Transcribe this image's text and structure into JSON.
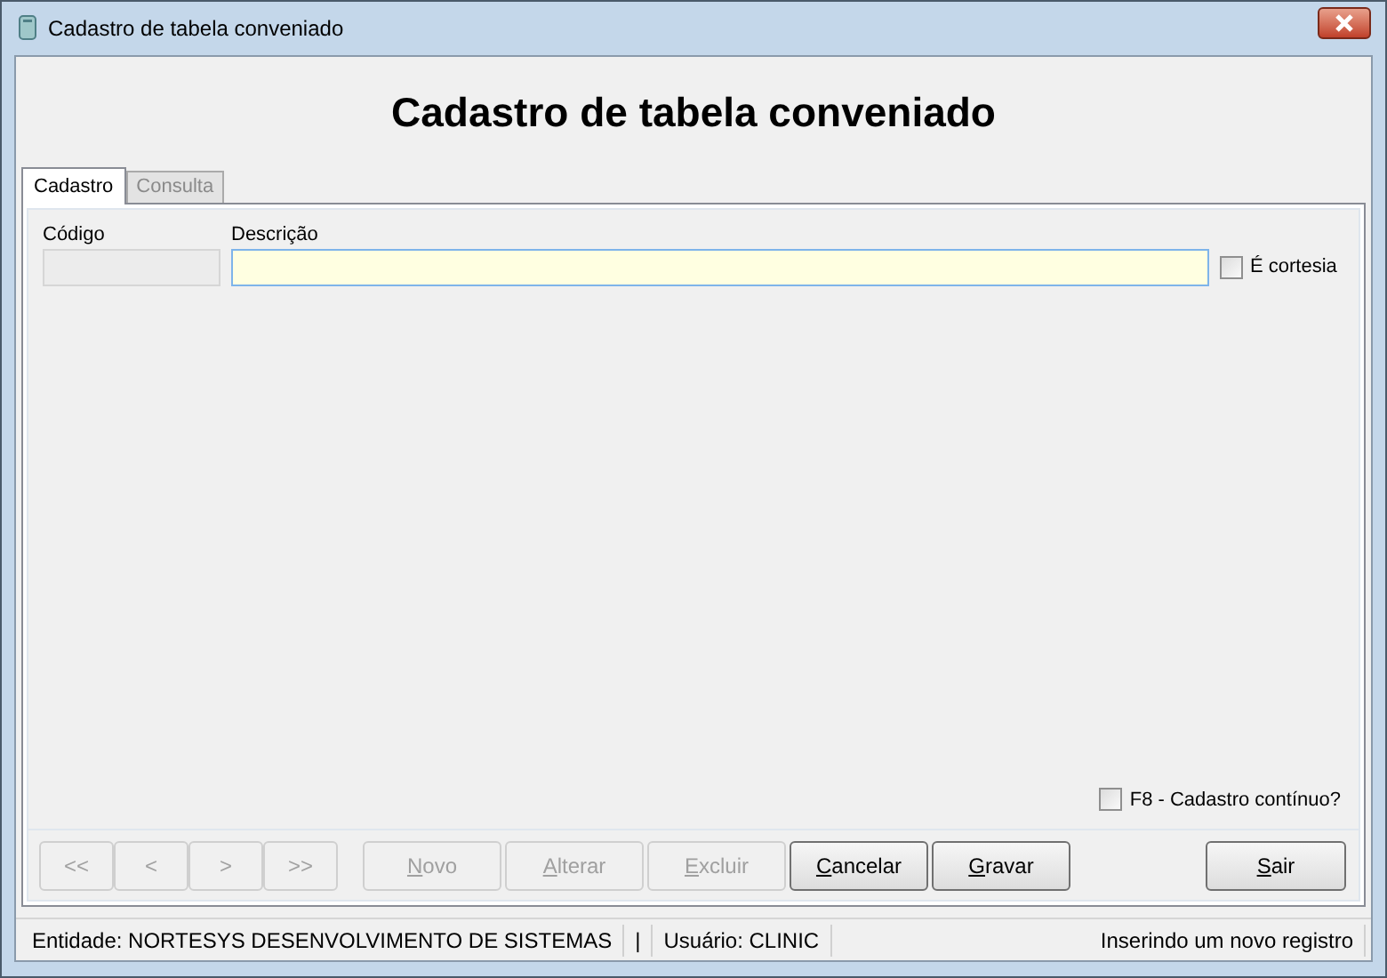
{
  "window": {
    "title": "Cadastro de tabela conveniado"
  },
  "heading": "Cadastro de tabela conveniado",
  "tabs": [
    {
      "label": "Cadastro",
      "selected": true
    },
    {
      "label": "Consulta",
      "selected": false
    }
  ],
  "fields": {
    "codigo": {
      "label": "Código",
      "disabled": true
    },
    "descricao": {
      "label": "Descrição",
      "disabled": false
    }
  },
  "cortesia": {
    "label": "É cortesia",
    "checked": false
  },
  "continuous": {
    "label": "F8 - Cadastro contínuo?",
    "checked": false
  },
  "nav_buttons": [
    {
      "label": "<<",
      "disabled": true
    },
    {
      "label": "<",
      "disabled": true
    },
    {
      "label": ">",
      "disabled": true
    },
    {
      "label": ">>",
      "disabled": true
    }
  ],
  "actions": [
    {
      "label": "Novo",
      "disabled": true,
      "mnemonic": true
    },
    {
      "label": "Alterar",
      "disabled": true,
      "mnemonic": true
    },
    {
      "label": "Excluir",
      "disabled": true,
      "mnemonic": true
    },
    {
      "label": "Cancelar",
      "disabled": false,
      "mnemonic": true
    },
    {
      "label": "Gravar",
      "disabled": false,
      "mnemonic": true
    }
  ],
  "exit_button": {
    "label": "Sair",
    "disabled": false,
    "mnemonic": true
  },
  "status_bar": [
    "Entidade: NORTESYS DESENVOLVIMENTO DE SISTEMAS",
    "|",
    "Usuário: CLINIC",
    "Inserindo um novo registro"
  ]
}
